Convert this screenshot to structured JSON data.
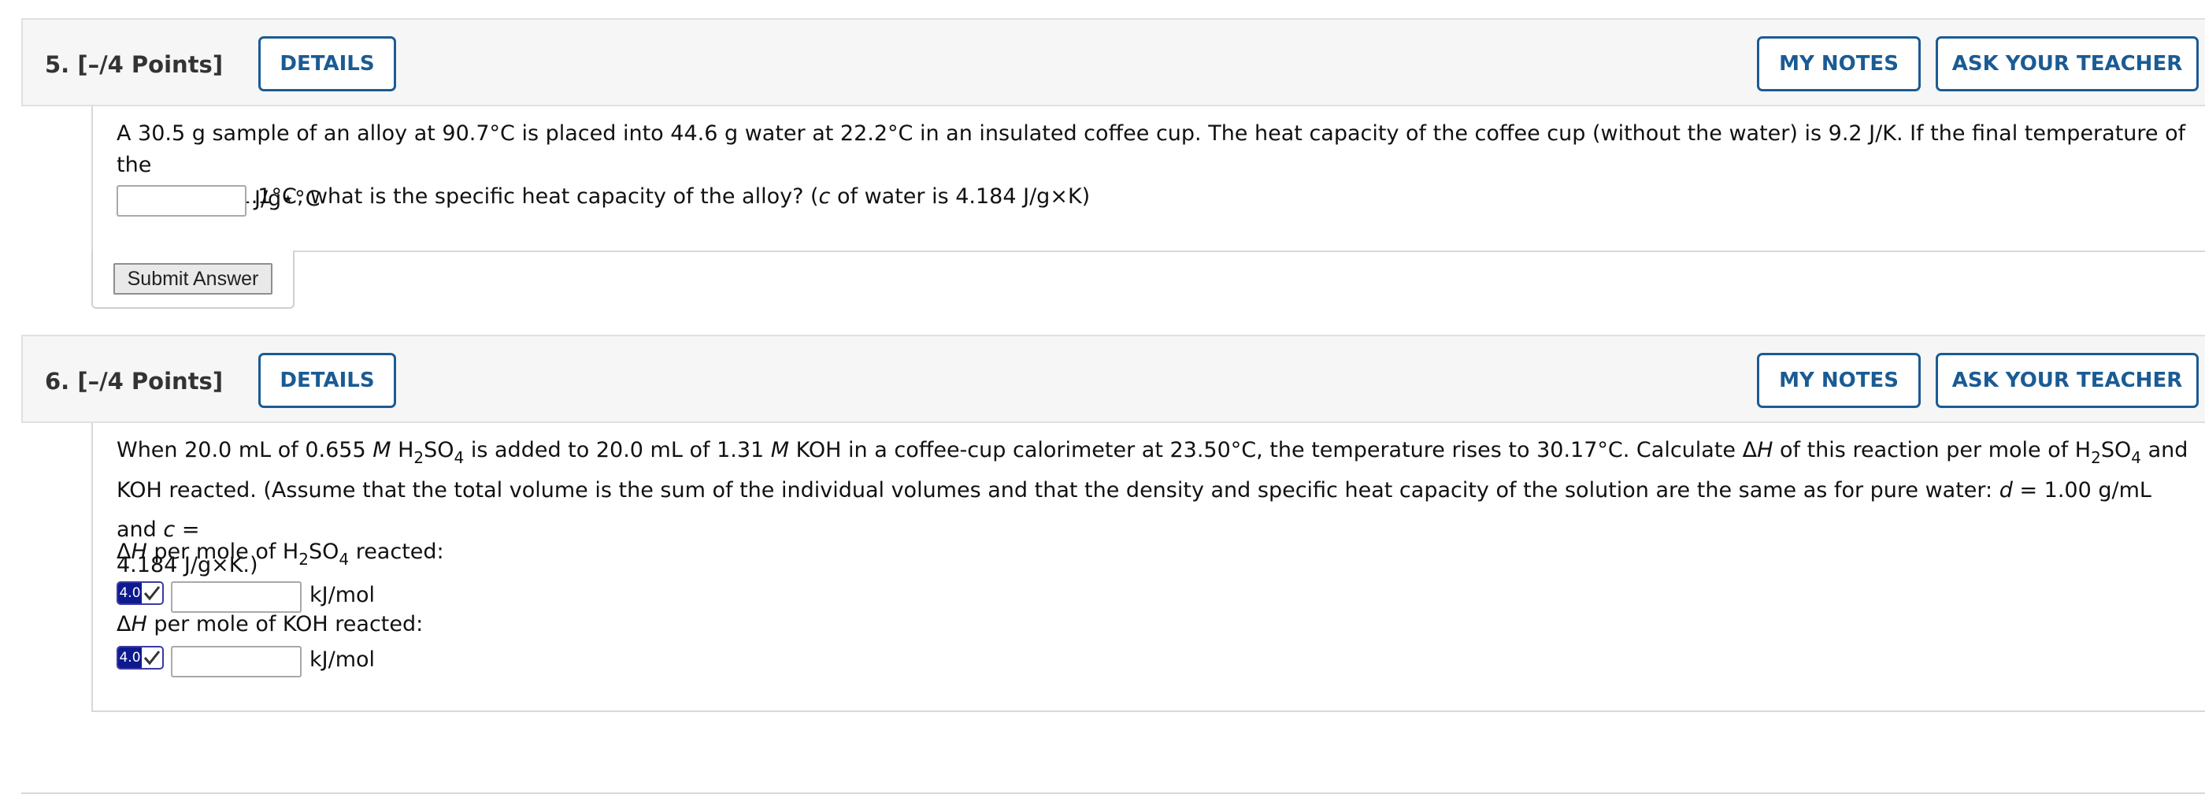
{
  "question5": {
    "number": "5.",
    "points": "[–/4 Points]",
    "details_label": "DETAILS",
    "notes_label": "MY NOTES",
    "ask_label": "ASK YOUR TEACHER",
    "text_line1": "A 30.5 g sample of an alloy at 90.7°C is placed into 44.6 g water at 22.2°C in an insulated coffee cup. The heat capacity of the coffee cup (without the water) is 9.2 J/K. If the final temperature of the",
    "text_line2_a": "system is 31.1°C, what is the specific heat capacity of the alloy? (",
    "text_line2_c": "c",
    "text_line2_b": " of water is 4.184 J/g×K)",
    "answer_value": "",
    "unit": "J/g⋆°C",
    "submit_label": "Submit Answer"
  },
  "question6": {
    "number": "6.",
    "points": "[–/4 Points]",
    "details_label": "DETAILS",
    "notes_label": "MY NOTES",
    "ask_label": "ASK YOUR TEACHER",
    "line1_a": "When 20.0 mL of 0.655 ",
    "molar_symbol": "M",
    "line1_b": " H",
    "sub2": "2",
    "line1_c": "SO",
    "sub4": "4",
    "line1_d": " is added to 20.0 mL of 1.31 ",
    "line1_e": " KOH in a coffee-cup calorimeter at 23.50°C, the temperature rises to 30.17°C. Calculate Δ",
    "enthalpy_symbol": "H",
    "line1_f": " of this reaction per mole of H",
    "line1_g": " and",
    "line2_a": "KOH reacted. (Assume that the total volume is the sum of the individual volumes and that the density and specific heat capacity of the solution are the same as for pure water: ",
    "density_symbol": "d",
    "line2_b": " = 1.00 g/mL and ",
    "heat_symbol": "c",
    "line2_c": " =",
    "line3": "4.184 J/g×K.)",
    "prompt1_delta": "Δ",
    "prompt1_a": " per mole of H",
    "prompt1_b": " reacted:",
    "prompt2_a": " per mole of KOH reacted:",
    "badge_num": "4.0",
    "answer1_value": "",
    "answer2_value": "",
    "unit": "kJ/mol"
  },
  "colors": {
    "accent": "#1b5b94",
    "badge": "#0d1a8f",
    "header_bg": "#f6f6f6"
  }
}
